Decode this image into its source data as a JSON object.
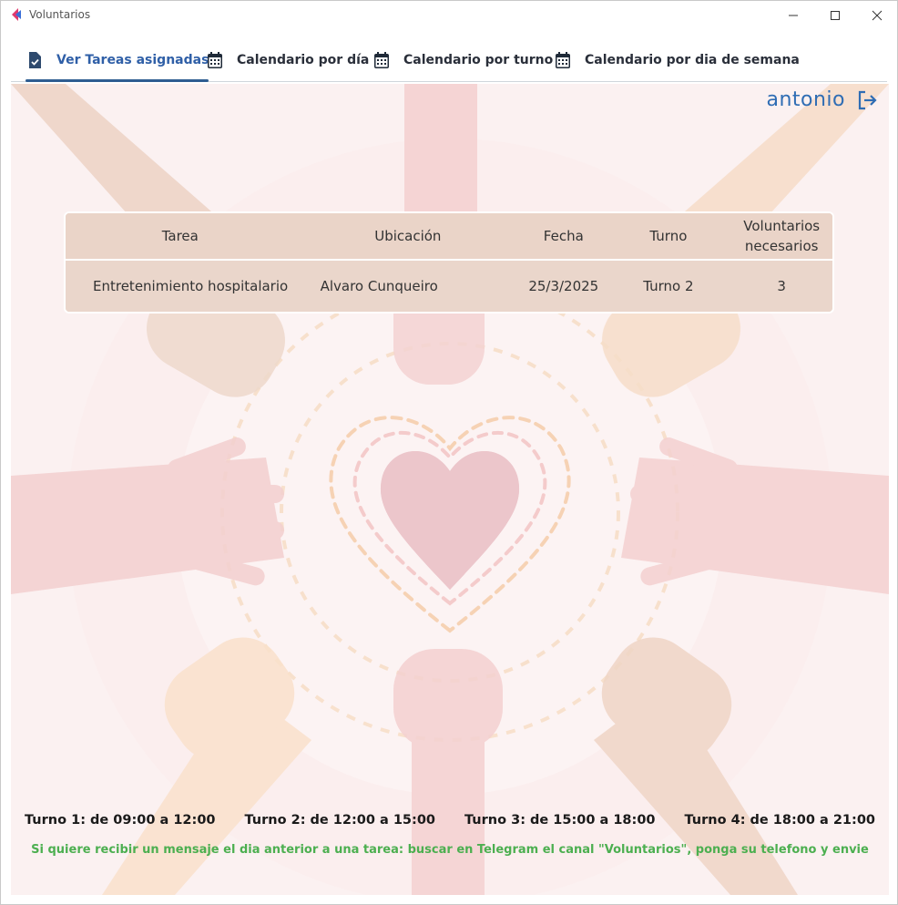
{
  "window": {
    "title": "Voluntarios"
  },
  "tabs": [
    {
      "label": "Ver Tareas asignadas",
      "icon": "assignment-check-icon",
      "active": true
    },
    {
      "label": "Calendario por día",
      "icon": "calendar-icon",
      "active": false
    },
    {
      "label": "Calendario por turno",
      "icon": "calendar-icon",
      "active": false
    },
    {
      "label": "Calendario por dia de semana",
      "icon": "calendar-icon",
      "active": false
    }
  ],
  "user": {
    "name": "antonio",
    "logout_icon": "logout-icon"
  },
  "table": {
    "headers": [
      "Tarea",
      "Ubicación",
      "Fecha",
      "Turno",
      "Voluntarios necesarios"
    ],
    "rows": [
      [
        "Entretenimiento hospitalario",
        "Alvaro Cunqueiro",
        "25/3/2025",
        "Turno 2",
        "3"
      ]
    ]
  },
  "turnos": [
    "Turno 1: de 09:00 a 12:00",
    "Turno 2: de 12:00 a 15:00",
    "Turno 3: de 15:00 a 18:00",
    "Turno 4: de 18:00 a 21:00"
  ],
  "note": "Si quiere recibir un mensaje el dia anterior a una tarea: buscar en Telegram el canal  \"Voluntarios\", ponga su telefono y envie",
  "colors": {
    "accent": "#2f6db4",
    "tab_underline": "#2e5d91",
    "note": "#4caf50",
    "table_bg": "#ead6cb"
  }
}
